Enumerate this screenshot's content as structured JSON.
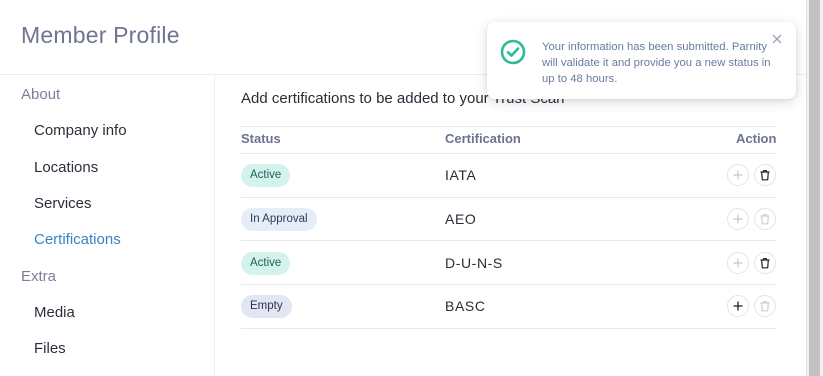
{
  "page": {
    "title": "Member Profile"
  },
  "sidebar": {
    "sections": [
      {
        "label": "About",
        "items": [
          "Company info",
          "Locations",
          "Services",
          "Certifications"
        ]
      },
      {
        "label": "Extra",
        "items": [
          "Media",
          "Files"
        ]
      }
    ],
    "active_item": "Certifications"
  },
  "main": {
    "intro": "Add certifications to be added to your Trust Scan",
    "columns": {
      "status": "Status",
      "certification": "Certification",
      "action": "Action"
    },
    "rows": [
      {
        "status": "Active",
        "status_kind": "active",
        "certification": "IATA",
        "add_enabled": false,
        "delete_enabled": true
      },
      {
        "status": "In Approval",
        "status_kind": "approval",
        "certification": "AEO",
        "add_enabled": false,
        "delete_enabled": false
      },
      {
        "status": "Active",
        "status_kind": "active",
        "certification": "D-U-N-S",
        "add_enabled": false,
        "delete_enabled": true
      },
      {
        "status": "Empty",
        "status_kind": "empty",
        "certification": "BASC",
        "add_enabled": true,
        "delete_enabled": false
      }
    ]
  },
  "toast": {
    "message": "Your information has been submitted. Parnity will validate it and provide you a new status in up to 48 hours.",
    "icon": "check-circle-icon",
    "close_icon": "close-icon"
  },
  "colors": {
    "accent": "#3b82c4",
    "success": "#2fb99a",
    "active_badge_bg": "#d4f3ec",
    "approval_badge_bg": "#e6edf8",
    "empty_badge_bg": "#e2e6f3"
  }
}
